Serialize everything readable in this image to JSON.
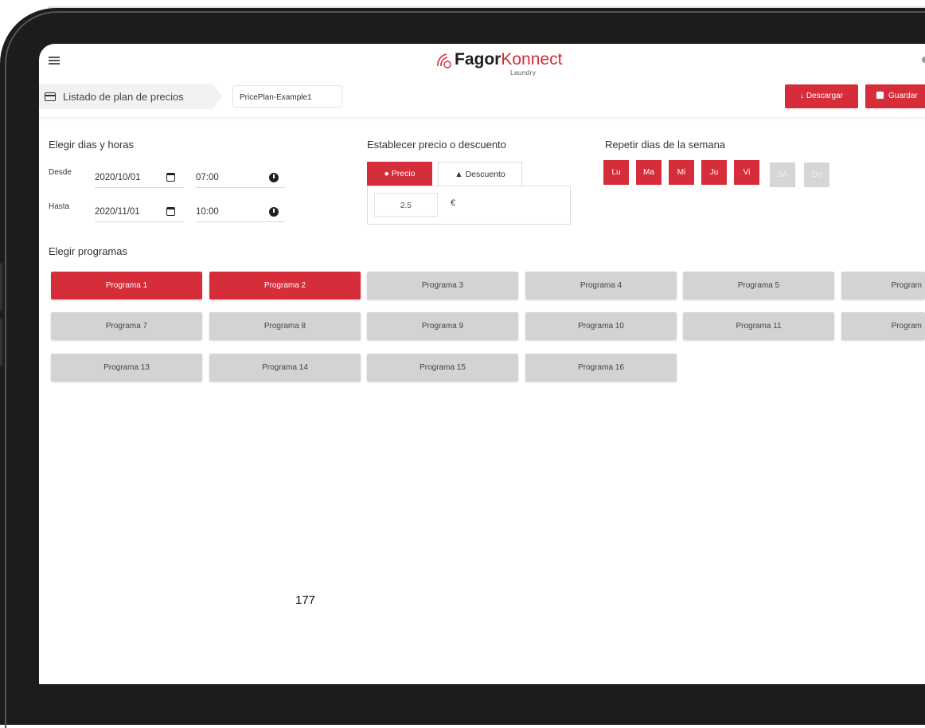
{
  "brand": {
    "name_bold": "Fagor",
    "name_light": "Konnect",
    "sub": "Laundry",
    "accent": "#d52d3a"
  },
  "header": {
    "breadcrumb": "Listado de plan de precios",
    "plan_name": "PricePlan-Example1",
    "download_label": "Descargar",
    "save_label": "Guardar"
  },
  "schedule": {
    "title": "Elegir dias y horas",
    "from_label": "Desde",
    "from_date": "2020/10/01",
    "from_time": "07:00",
    "to_label": "Hasta",
    "to_date": "2020/11/01",
    "to_time": "10:00"
  },
  "price": {
    "title": "Establecer precio o descuento",
    "tab_price": "Precio",
    "tab_discount": "Descuento",
    "value": "2.5",
    "currency": "€"
  },
  "repeat": {
    "title": "Repetir dias de la semana",
    "days": [
      {
        "label": "Lu",
        "active": true
      },
      {
        "label": "Ma",
        "active": true
      },
      {
        "label": "Mi",
        "active": true
      },
      {
        "label": "Ju",
        "active": true
      },
      {
        "label": "Vi",
        "active": true
      },
      {
        "label": "SÁ",
        "active": false
      },
      {
        "label": "Do",
        "active": false
      }
    ]
  },
  "programs": {
    "title": "Elegir programas",
    "items": [
      {
        "label": "Programa 1",
        "active": true
      },
      {
        "label": "Programa 2",
        "active": true
      },
      {
        "label": "Programa 3",
        "active": false
      },
      {
        "label": "Programa 4",
        "active": false
      },
      {
        "label": "Programa 5",
        "active": false
      },
      {
        "label": "Program",
        "active": false
      },
      {
        "label": "Programa 7",
        "active": false
      },
      {
        "label": "Programa 8",
        "active": false
      },
      {
        "label": "Programa 9",
        "active": false
      },
      {
        "label": "Programa 10",
        "active": false
      },
      {
        "label": "Programa 11",
        "active": false
      },
      {
        "label": "Program",
        "active": false
      },
      {
        "label": "Programa 13",
        "active": false
      },
      {
        "label": "Programa 14",
        "active": false
      },
      {
        "label": "Programa 15",
        "active": false
      },
      {
        "label": "Programa 16",
        "active": false
      }
    ]
  },
  "page_number": "177"
}
